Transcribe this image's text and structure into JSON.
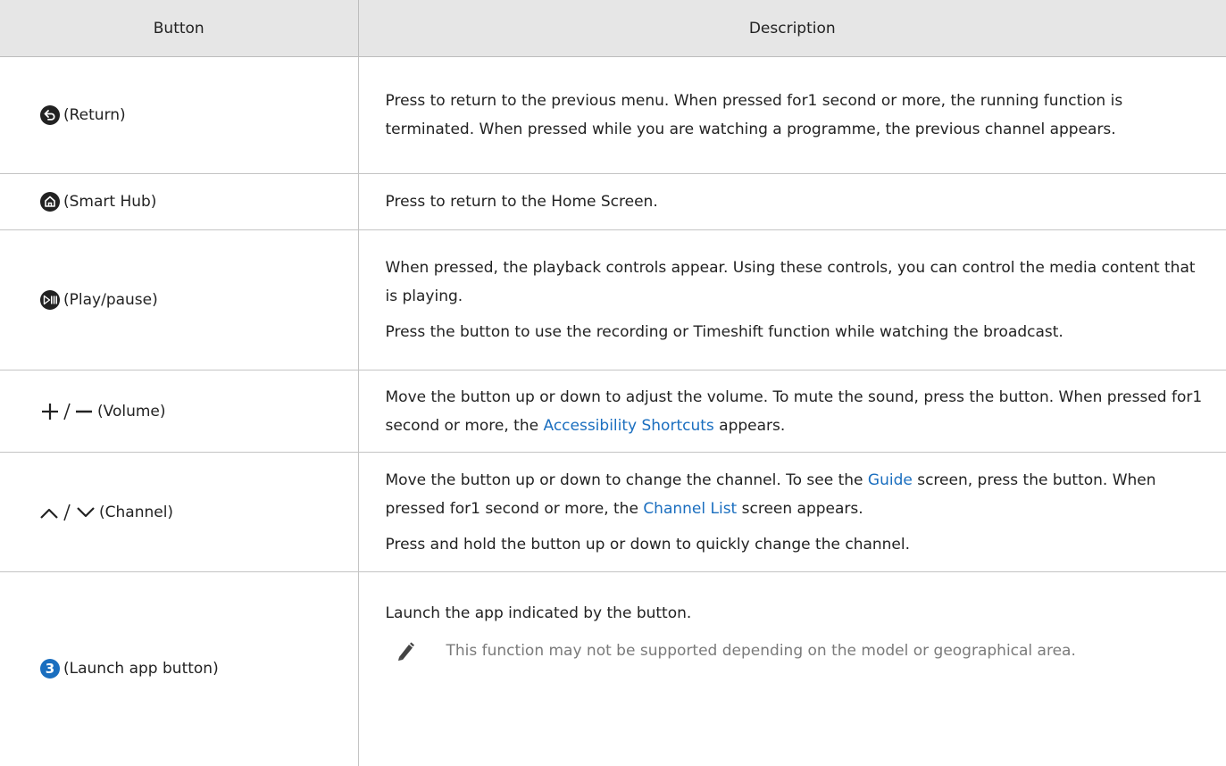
{
  "table": {
    "header": {
      "button": "Button",
      "description": "Description"
    },
    "rows": {
      "return": {
        "icon": "return-icon",
        "label": "(Return)",
        "desc": "Press to return to the previous menu. When pressed for1 second or more, the running function is terminated. When pressed while you are watching a programme, the previous channel appears."
      },
      "smarthub": {
        "icon": "home-icon",
        "label": "(Smart Hub)",
        "desc": "Press to return to the Home Screen."
      },
      "playpause": {
        "icon": "play-pause-icon",
        "label": "(Play/pause)",
        "desc1": "When pressed, the playback controls appear. Using these controls, you can control the media content that is playing.",
        "desc2": "Press the button to use the recording or Timeshift function while watching the broadcast."
      },
      "volume": {
        "icon": "plus-minus-icon",
        "label": "(Volume)",
        "desc_a": "Move the button up or down to adjust the volume. To mute the sound, press the button. When pressed for1 second or more, the ",
        "link": "Accessibility Shortcuts",
        "desc_b": " appears."
      },
      "channel": {
        "icon": "chevron-up-down-icon",
        "label": "(Channel)",
        "desc_a": "Move the button up or down to change the channel. To see the ",
        "link1": "Guide",
        "desc_b": " screen, press the button. When pressed for1 second or more, the ",
        "link2": "Channel List",
        "desc_c": " screen appears.",
        "desc2": "Press and hold the button up or down to quickly change the channel."
      },
      "launch": {
        "icon": "number-3-icon",
        "icon_text": "3",
        "label": "(Launch app button)",
        "desc": "Launch the app indicated by the button.",
        "note": "This function may not be supported depending on the model or geographical area."
      }
    }
  },
  "colors": {
    "header_bg": "#e6e6e6",
    "link": "#1a6ebf",
    "badge": "#1a6ebf",
    "note_text": "#7a7a7a",
    "icon": "#222222"
  }
}
